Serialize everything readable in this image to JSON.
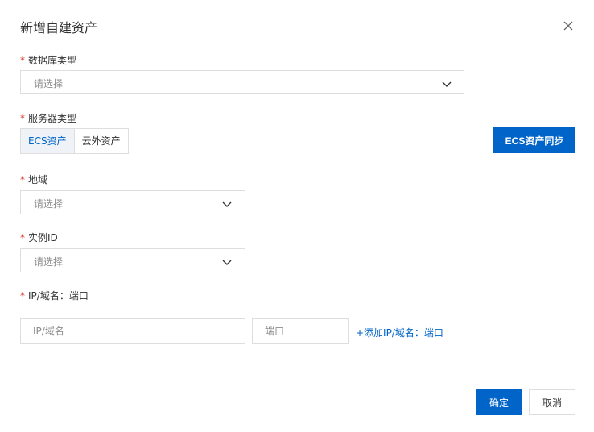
{
  "dialog": {
    "title": "新增自建资产",
    "close_icon": "close-icon"
  },
  "fields": {
    "db_type": {
      "required": "*",
      "label": "数据库类型",
      "placeholder": "请选择"
    },
    "server_type": {
      "required": "*",
      "label": "服务器类型",
      "options": [
        "ECS资产",
        "云外资产"
      ],
      "selected": "ECS资产",
      "sync_button": "ECS资产同步"
    },
    "region": {
      "required": "*",
      "label": "地域",
      "placeholder": "请选择"
    },
    "instance_id": {
      "required": "*",
      "label": "实例ID",
      "placeholder": "请选择"
    },
    "endpoint": {
      "required": "*",
      "label": "IP/域名：端口",
      "ip_placeholder": "IP/域名",
      "port_placeholder": "端口",
      "add_link": "+添加IP/域名：端口"
    }
  },
  "footer": {
    "confirm": "确定",
    "cancel": "取消"
  },
  "colors": {
    "accent": "#0064c8",
    "required": "#d93026",
    "border": "#dedede"
  }
}
